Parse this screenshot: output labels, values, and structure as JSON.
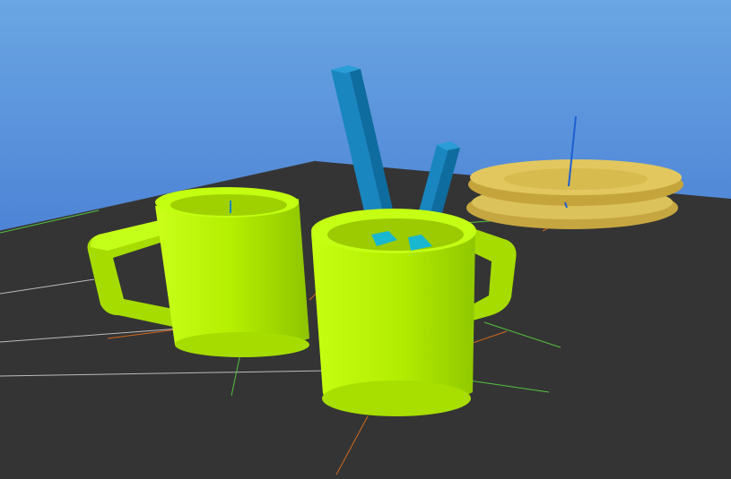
{
  "scene": {
    "objects": [
      {
        "name": "left-mug",
        "color": "#b8f000"
      },
      {
        "name": "right-mug",
        "color": "#b8f000"
      },
      {
        "name": "stick-tall",
        "color": "#1a86c0"
      },
      {
        "name": "stick-short",
        "color": "#1a86c0"
      },
      {
        "name": "plate-stack",
        "color": "#d6b84a"
      }
    ],
    "colors": {
      "sky_top": "#6aa6e3",
      "sky_bottom": "#2e5fc7",
      "table": "#343434",
      "mug": "#b8f000",
      "mug_dark": "#9ed200",
      "stick": "#1a86c0",
      "plate": "#d6b84a"
    }
  }
}
